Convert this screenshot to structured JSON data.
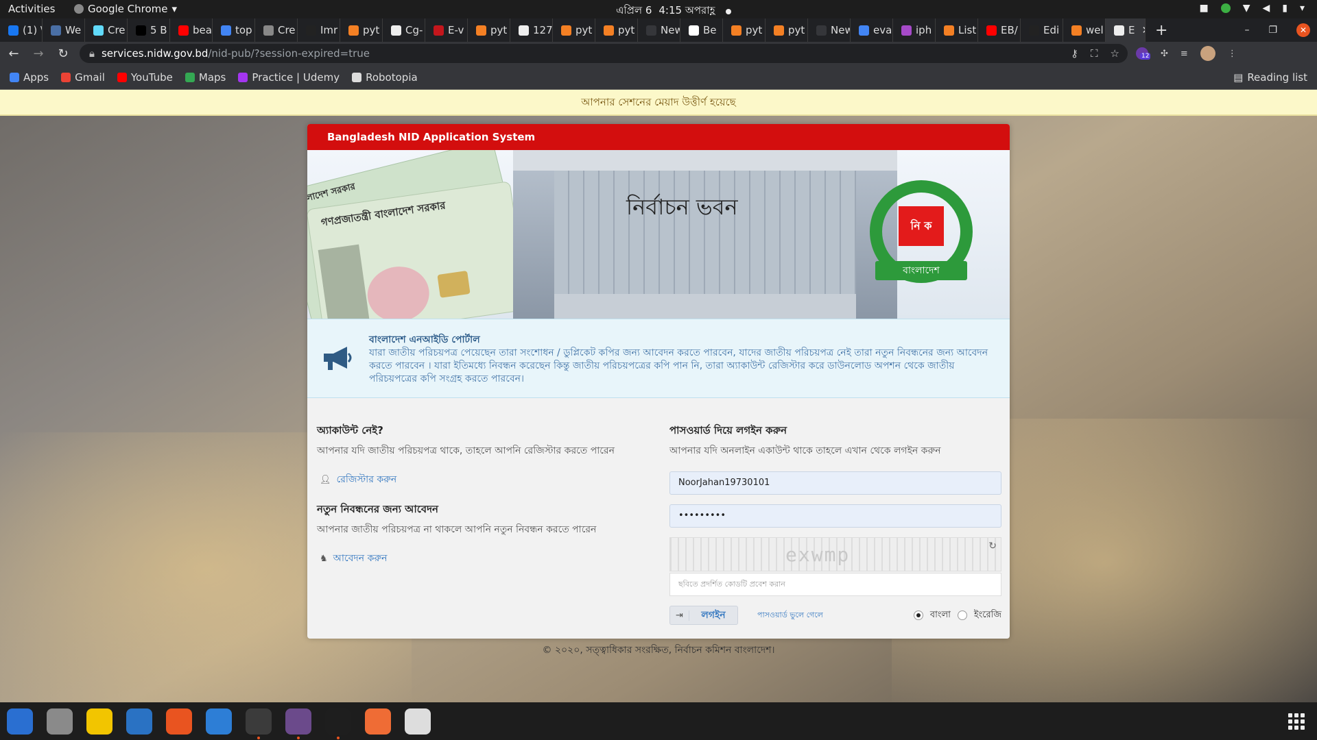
{
  "gnome": {
    "activities": "Activities",
    "app_name": "Google Chrome",
    "clock_date": "এপ্রিল 6",
    "clock_time": "4:15 অপরাহ্ণ"
  },
  "chrome": {
    "tabs": [
      {
        "title": "(1) \\",
        "color": "#1877f2"
      },
      {
        "title": "We",
        "color": "#4a6fa5"
      },
      {
        "title": "Cre",
        "color": "#61dafb"
      },
      {
        "title": "5 B",
        "color": "#000000"
      },
      {
        "title": "bea",
        "color": "#ff0000"
      },
      {
        "title": "top",
        "color": "#4285f4"
      },
      {
        "title": "Cre",
        "color": "#888888"
      },
      {
        "title": "Imr",
        "color": "#222222"
      },
      {
        "title": "pyt",
        "color": "#f48024"
      },
      {
        "title": "Cg-",
        "color": "#eeeeee"
      },
      {
        "title": "E-v",
        "color": "#c4161c"
      },
      {
        "title": "pyt",
        "color": "#f48024"
      },
      {
        "title": "127",
        "color": "#eeeeee"
      },
      {
        "title": "pyt",
        "color": "#f48024"
      },
      {
        "title": "pyt",
        "color": "#f48024"
      },
      {
        "title": "New T",
        "color": "#35363a"
      },
      {
        "title": "Be",
        "color": "#ffffff"
      },
      {
        "title": "pyt",
        "color": "#f48024"
      },
      {
        "title": "pyt",
        "color": "#f48024"
      },
      {
        "title": "New T",
        "color": "#35363a"
      },
      {
        "title": "eva",
        "color": "#4285f4"
      },
      {
        "title": "iph",
        "color": "#a64ac9"
      },
      {
        "title": "List",
        "color": "#f48024"
      },
      {
        "title": "EB/",
        "color": "#ff0000"
      },
      {
        "title": "Edi",
        "color": "#222222"
      },
      {
        "title": "wel",
        "color": "#f48024"
      },
      {
        "title": "E",
        "color": "#eeeeee"
      }
    ],
    "url_host": "services.nidw.gov.bd",
    "url_path": "/nid-pub/?session-expired=true",
    "bookmarks": [
      {
        "label": "Apps",
        "icon": "apps-icon",
        "color": "#4285f4"
      },
      {
        "label": "Gmail",
        "icon": "gmail-icon",
        "color": "#ea4335"
      },
      {
        "label": "YouTube",
        "icon": "youtube-icon",
        "color": "#ff0000"
      },
      {
        "label": "Maps",
        "icon": "maps-icon",
        "color": "#34a853"
      },
      {
        "label": "Practice | Udemy",
        "icon": "udemy-icon",
        "color": "#a435f0"
      },
      {
        "label": "Robotopia",
        "icon": "globe-icon",
        "color": "#dddddd"
      }
    ],
    "reading_list": "Reading list",
    "ext_badge": "12"
  },
  "page": {
    "session_expired": "আপনার সেশনের মেয়াদ উত্তীর্ণ হয়েছে",
    "header_title": "Bangladesh NID Application System",
    "banner": {
      "building_name": "নির্বাচন ভবন",
      "card_text_1": "গণপ্রজাতন্ত্রী বাংলাদেশ সরকার",
      "card_text_2": "বাংলাদেশ সরকার",
      "seal_box": "নি ক",
      "seal_ribbon": "বাংলাদেশ"
    },
    "notice": {
      "title": "বাংলাদেশ এনআইডি পোর্টাল",
      "body": "যারা জাতীয় পরিচয়পত্র পেয়েছেন তারা সংশোধন / ডুপ্লিকেট কপির জন্য আবেদন করতে পারবেন, যাদের জাতীয় পরিচয়পত্র নেই তারা নতুন নিবন্ধনের জন্য আবেদন করতে পারবেন । যারা ইতিমধ্যে নিবন্ধন করেছেন কিন্তু জাতীয় পরিচয়পত্রের কপি পান নি, তারা অ্যাকাউন্ট রেজিস্টার করে ডাউনলোড অপশন থেকে জাতীয় পরিচয়পত্রের কপি সংগ্রহ করতে পারবেন।"
    },
    "left": {
      "no_account_title": "অ্যাকাউন্ট নেই?",
      "no_account_desc": "আপনার যদি জাতীয় পরিচয়পত্র থাকে, তাহলে আপনি রেজিস্টার করতে পারেন",
      "register_link": "রেজিস্টার করুন",
      "new_reg_title": "নতুন নিবন্ধনের জন্য আবেদন",
      "new_reg_desc": "আপনার জাতীয় পরিচয়পত্র না থাকলে আপনি নতুন নিবন্ধন করতে পারেন",
      "apply_link": "আবেদন করুন"
    },
    "right": {
      "login_title": "পাসওয়ার্ড দিয়ে লগইন করুন",
      "login_desc": "আপনার যদি অনলাইন একাউন্ট থাকে তাহলে এখান থেকে লগইন করুন",
      "username": "NoorJahan19730101",
      "password_mask": "•••••••••",
      "captcha_text": "exwmp",
      "captcha_placeholder": "ছবিতে প্রদর্শিত কোডটি প্রবেশ করান",
      "login_button": "লগইন",
      "forgot_password": "পাসওয়ার্ড ভুলে গেলে",
      "lang_bangla": "বাংলা",
      "lang_english": "ইংরেজি",
      "selected_lang": "বাংলা"
    },
    "footer": "© ২০২০, সত্ত্বাধিকার সংরক্ষিত, নির্বাচন কমিশন বাংলাদেশ।"
  },
  "dock": [
    {
      "name": "thunderbird-icon",
      "color": "#2a6fd1"
    },
    {
      "name": "files-icon",
      "color": "#8a8a8a"
    },
    {
      "name": "rhythmbox-icon",
      "color": "#f2c500"
    },
    {
      "name": "writer-icon",
      "color": "#2a72c3"
    },
    {
      "name": "software-icon",
      "color": "#e95420"
    },
    {
      "name": "help-icon",
      "color": "#2d7ed6"
    },
    {
      "name": "chrome-icon",
      "color": "#3b3b3b"
    },
    {
      "name": "video-icon",
      "color": "#6b4a8b"
    },
    {
      "name": "vscode-icon",
      "color": "#1e1e1e"
    },
    {
      "name": "postman-icon",
      "color": "#ef6c35"
    },
    {
      "name": "screenshot-icon",
      "color": "#dddddd"
    }
  ]
}
